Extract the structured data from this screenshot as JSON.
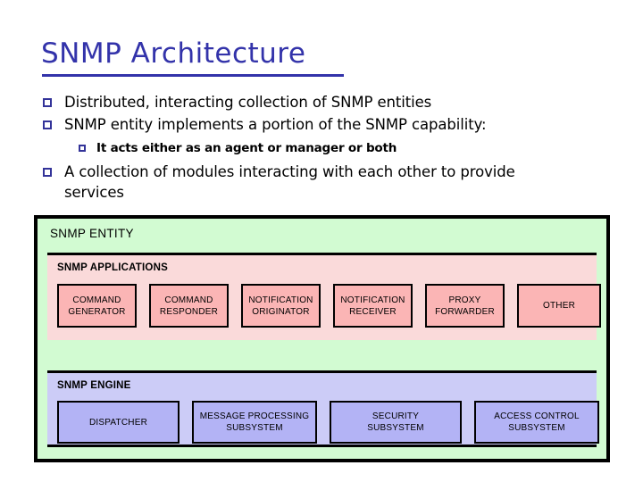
{
  "slide": {
    "title": "SNMP Architecture",
    "title_color": "#3333aa"
  },
  "bullets": [
    {
      "level": 1,
      "text": "Distributed, interacting collection of SNMP entities"
    },
    {
      "level": 1,
      "text": "SNMP entity implements a portion of the SNMP capability:"
    },
    {
      "level": 2,
      "text": "It acts either as an agent or manager or both"
    },
    {
      "level": 1,
      "text": "A collection of modules interacting with each other to provide services"
    }
  ],
  "diagram": {
    "entity_label": "SNMP ENTITY",
    "entity_bg": "#d2fbd2",
    "applications": {
      "label": "SNMP APPLICATIONS",
      "band_bg": "#fadada",
      "box_bg": "#fbb5b5",
      "boxes": [
        {
          "line1": "COMMAND",
          "line2": "GENERATOR"
        },
        {
          "line1": "COMMAND",
          "line2": "RESPONDER"
        },
        {
          "line1": "NOTIFICATION",
          "line2": "ORIGINATOR"
        },
        {
          "line1": "NOTIFICATION",
          "line2": "RECEIVER"
        },
        {
          "line1": "PROXY",
          "line2": "FORWARDER"
        },
        {
          "line1": "OTHER",
          "line2": ""
        }
      ]
    },
    "engine": {
      "label": "SNMP ENGINE",
      "band_bg": "#ccccf7",
      "box_bg": "#b3b3f5",
      "boxes": [
        {
          "line1": "DISPATCHER",
          "line2": ""
        },
        {
          "line1": "MESSAGE PROCESSING",
          "line2": "SUBSYSTEM"
        },
        {
          "line1": "SECURITY",
          "line2": "SUBSYSTEM"
        },
        {
          "line1": "ACCESS CONTROL",
          "line2": "SUBSYSTEM"
        }
      ]
    }
  }
}
